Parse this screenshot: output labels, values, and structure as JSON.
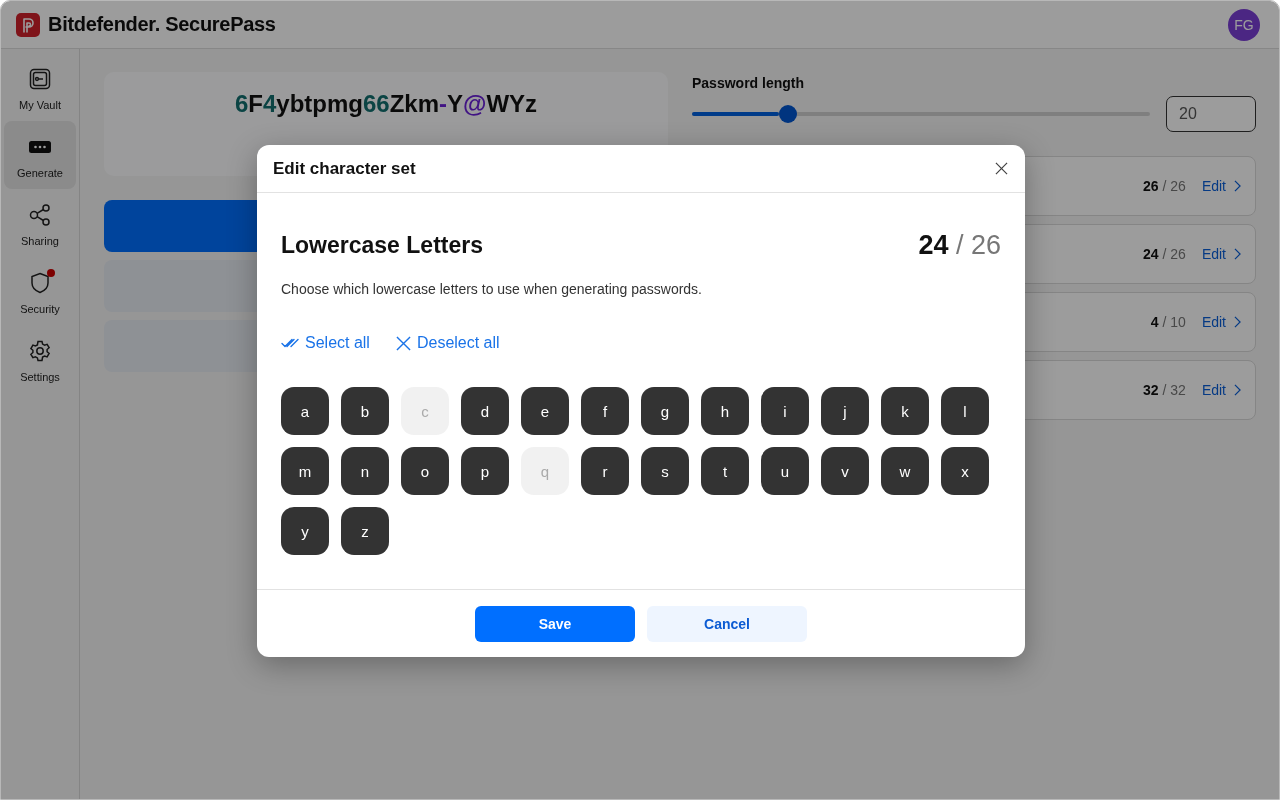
{
  "header": {
    "brand": "Bitdefender. SecurePass",
    "avatar": "FG"
  },
  "sidebar": {
    "items": [
      {
        "label": "My Vault",
        "selected": false,
        "alert": false
      },
      {
        "label": "Generate",
        "selected": true,
        "alert": false
      },
      {
        "label": "Sharing",
        "selected": false,
        "alert": false
      },
      {
        "label": "Security",
        "selected": false,
        "alert": true
      },
      {
        "label": "Settings",
        "selected": false,
        "alert": false
      }
    ]
  },
  "generator": {
    "password": [
      {
        "text": "6",
        "kind": "digit"
      },
      {
        "text": "F",
        "kind": "letter"
      },
      {
        "text": "4",
        "kind": "digit"
      },
      {
        "text": "ybtpmg",
        "kind": "letter"
      },
      {
        "text": "66",
        "kind": "digit"
      },
      {
        "text": "Zkm",
        "kind": "letter"
      },
      {
        "text": "-",
        "kind": "symbol"
      },
      {
        "text": "Y",
        "kind": "letter"
      },
      {
        "text": "@",
        "kind": "symbol"
      },
      {
        "text": "WYz",
        "kind": "letter"
      }
    ],
    "actions": [
      {
        "kind": "primary"
      },
      {
        "kind": "secondary"
      },
      {
        "kind": "secondary"
      }
    ]
  },
  "length": {
    "label": "Password length",
    "level": 0.21,
    "value": "20"
  },
  "character_sets": [
    {
      "count": "26",
      "of": "/ 26",
      "link": "Edit"
    },
    {
      "count": "24",
      "of": "/ 26",
      "link": "Edit"
    },
    {
      "count": "4",
      "of": "/ 10",
      "link": "Edit"
    },
    {
      "count": "32",
      "of": "/ 32",
      "link": "Edit"
    }
  ],
  "dialog": {
    "title": "Edit character set",
    "heading": "Lowercase Letters",
    "count": "24",
    "of": "/ 26",
    "description": "Choose which lowercase letters to use when generating passwords.",
    "select_all": "Select all",
    "deselect_all": "Deselect all",
    "letters": [
      {
        "char": "a",
        "selected": true
      },
      {
        "char": "b",
        "selected": true
      },
      {
        "char": "c",
        "selected": false
      },
      {
        "char": "d",
        "selected": true
      },
      {
        "char": "e",
        "selected": true
      },
      {
        "char": "f",
        "selected": true
      },
      {
        "char": "g",
        "selected": true
      },
      {
        "char": "h",
        "selected": true
      },
      {
        "char": "i",
        "selected": true
      },
      {
        "char": "j",
        "selected": true
      },
      {
        "char": "k",
        "selected": true
      },
      {
        "char": "l",
        "selected": true
      },
      {
        "char": "m",
        "selected": true
      },
      {
        "char": "n",
        "selected": true
      },
      {
        "char": "o",
        "selected": true
      },
      {
        "char": "p",
        "selected": true
      },
      {
        "char": "q",
        "selected": false
      },
      {
        "char": "r",
        "selected": true
      },
      {
        "char": "s",
        "selected": true
      },
      {
        "char": "t",
        "selected": true
      },
      {
        "char": "u",
        "selected": true
      },
      {
        "char": "v",
        "selected": true
      },
      {
        "char": "w",
        "selected": true
      },
      {
        "char": "x",
        "selected": true
      },
      {
        "char": "y",
        "selected": true
      },
      {
        "char": "z",
        "selected": true
      }
    ],
    "buttons": [
      {
        "label": "Save",
        "kind": "primary"
      },
      {
        "label": "Cancel",
        "kind": "secondary"
      }
    ]
  }
}
